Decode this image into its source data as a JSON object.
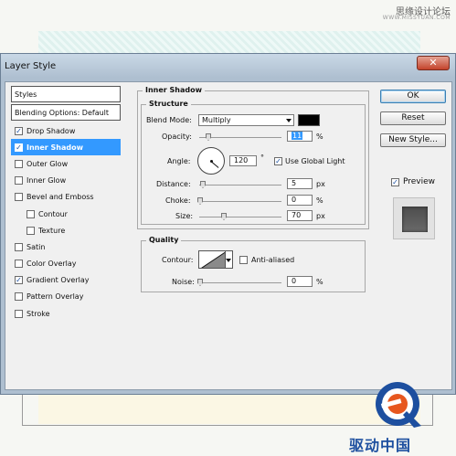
{
  "watermark": {
    "text": "思缘设计论坛",
    "sub": "WWW.MISSYUAN.COM"
  },
  "window": {
    "title": "Layer Style",
    "close_icon": "close-icon"
  },
  "styles": {
    "header": "Styles",
    "blending": "Blending Options: Default",
    "items": [
      {
        "label": "Drop Shadow",
        "checked": true
      },
      {
        "label": "Inner Shadow",
        "checked": true,
        "selected": true
      },
      {
        "label": "Outer Glow",
        "checked": false
      },
      {
        "label": "Inner Glow",
        "checked": false
      },
      {
        "label": "Bevel and Emboss",
        "checked": false
      },
      {
        "label": "Contour",
        "checked": false,
        "sub": true
      },
      {
        "label": "Texture",
        "checked": false,
        "sub": true
      },
      {
        "label": "Satin",
        "checked": false
      },
      {
        "label": "Color Overlay",
        "checked": false
      },
      {
        "label": "Gradient Overlay",
        "checked": true
      },
      {
        "label": "Pattern Overlay",
        "checked": false
      },
      {
        "label": "Stroke",
        "checked": false
      }
    ]
  },
  "panel": {
    "group_title": "Inner Shadow",
    "structure": {
      "title": "Structure",
      "blend_mode_label": "Blend Mode:",
      "blend_mode_value": "Multiply",
      "shadow_color": "#000000",
      "opacity_label": "Opacity:",
      "opacity_value": "11",
      "opacity_unit": "%",
      "angle_label": "Angle:",
      "angle_value": "120",
      "angle_unit": "°",
      "global_light_label": "Use Global Light",
      "global_light_checked": true,
      "distance_label": "Distance:",
      "distance_value": "5",
      "distance_unit": "px",
      "choke_label": "Choke:",
      "choke_value": "0",
      "choke_unit": "%",
      "size_label": "Size:",
      "size_value": "70",
      "size_unit": "px"
    },
    "quality": {
      "title": "Quality",
      "contour_label": "Contour:",
      "anti_aliased_label": "Anti-aliased",
      "anti_aliased_checked": false,
      "noise_label": "Noise:",
      "noise_value": "0",
      "noise_unit": "%"
    }
  },
  "buttons": {
    "ok": "OK",
    "reset": "Reset",
    "new_style": "New Style...",
    "preview_label": "Preview",
    "preview_checked": true
  },
  "logo": {
    "text": "驱动中国"
  }
}
